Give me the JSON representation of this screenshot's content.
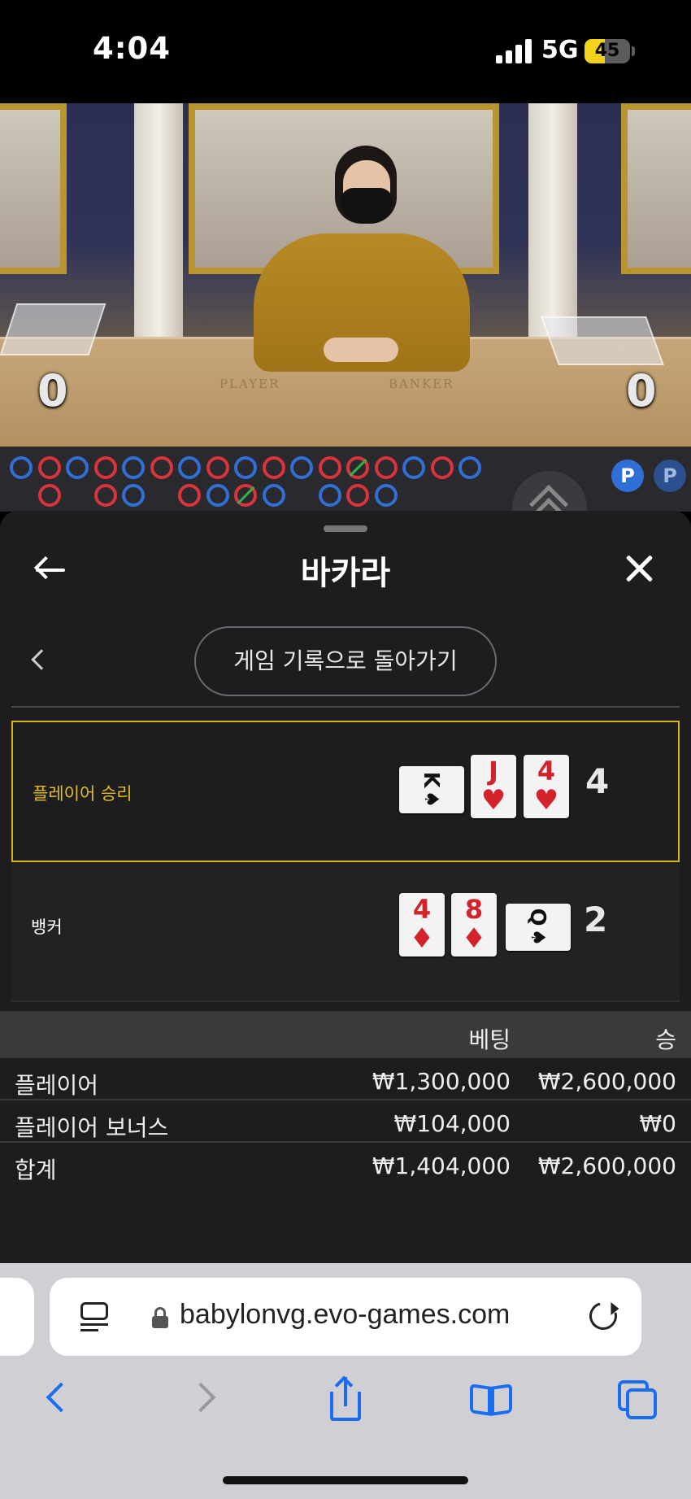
{
  "status_bar": {
    "time": "4:04",
    "network": "5G",
    "battery": "45",
    "battery_level": 0.45
  },
  "video": {
    "table_labels": [
      "PLAYER",
      "BANKER"
    ],
    "left_count": "0",
    "right_count": "0"
  },
  "roadmap": {
    "row1": [
      "p",
      "b",
      "p",
      "b",
      "p",
      "b",
      "p",
      "b",
      "p",
      "b",
      "p",
      "b",
      "tb",
      "b",
      "p",
      "b",
      "p"
    ],
    "row2": [
      "e",
      "b",
      "e",
      "b",
      "p",
      "e",
      "b",
      "p",
      "tb",
      "p",
      "e",
      "p",
      "b",
      "p"
    ],
    "side_badge": "P"
  },
  "sheet": {
    "title": "바카라",
    "history_button": "게임 기록으로 돌아가기"
  },
  "results": {
    "player": {
      "label": "플레이어 승리",
      "score": "4",
      "cards": [
        {
          "rank": "K",
          "suit": "♠",
          "color": "black",
          "orientation": "sideways"
        },
        {
          "rank": "J",
          "suit": "♥",
          "color": "red",
          "orientation": "upright"
        },
        {
          "rank": "4",
          "suit": "♥",
          "color": "red",
          "orientation": "upright"
        }
      ]
    },
    "banker": {
      "label": "뱅커",
      "score": "2",
      "cards": [
        {
          "rank": "4",
          "suit": "♦",
          "color": "red",
          "orientation": "upright"
        },
        {
          "rank": "8",
          "suit": "♦",
          "color": "red",
          "orientation": "upright"
        },
        {
          "rank": "Q",
          "suit": "♠",
          "color": "black",
          "orientation": "sideways"
        }
      ]
    }
  },
  "bet_table": {
    "headers": {
      "name": "",
      "bet": "베팅",
      "win": "승"
    },
    "rows": [
      {
        "name": "플레이어",
        "bet": "₩1,300,000",
        "win": "₩2,600,000"
      },
      {
        "name": "플레이어 보너스",
        "bet": "₩104,000",
        "win": "₩0"
      },
      {
        "name": "합계",
        "bet": "₩1,404,000",
        "win": "₩2,600,000"
      }
    ]
  },
  "browser": {
    "url": "babylonvg.evo-games.com",
    "icons": [
      "reader-icon",
      "lock-icon",
      "reload-icon",
      "back-icon",
      "forward-icon",
      "share-icon",
      "bookmarks-icon",
      "tabs-icon"
    ]
  },
  "colors": {
    "winner_outline": "#d4b31c",
    "player_blue": "#2f6fd6",
    "banker_red": "#d9333b",
    "tie_green": "#31b24a",
    "safari_blue": "#1a6df0"
  }
}
